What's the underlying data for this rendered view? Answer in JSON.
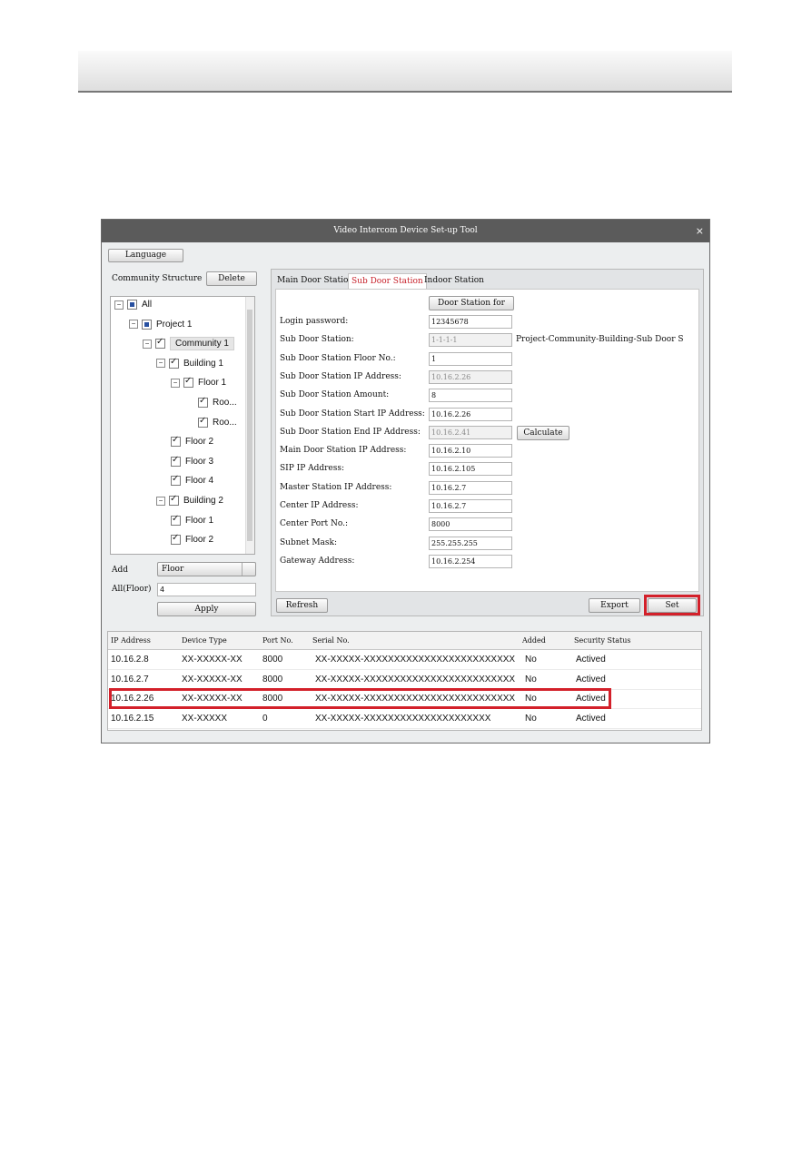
{
  "window": {
    "title": "Video Intercom Device Set-up Tool",
    "close_glyph": "×"
  },
  "toolbar": {
    "language_label": "Language"
  },
  "community": {
    "title": "Community Structure",
    "delete_label": "Delete",
    "tree": [
      {
        "label": "All",
        "level": 0,
        "expander": "−",
        "check": "part"
      },
      {
        "label": "Project 1",
        "level": 1,
        "expander": "−",
        "check": "part"
      },
      {
        "label": "Community 1",
        "level": 2,
        "expander": "−",
        "check": "chk",
        "selected": true
      },
      {
        "label": "Building 1",
        "level": 3,
        "expander": "−",
        "check": "chk"
      },
      {
        "label": "Floor 1",
        "level": 4,
        "expander": "−",
        "check": "chk"
      },
      {
        "label": "Roo...",
        "level": 5,
        "expander": "",
        "check": "chk"
      },
      {
        "label": "Roo...",
        "level": 5,
        "expander": "",
        "check": "chk"
      },
      {
        "label": "Floor 2",
        "level": 4,
        "expander": "",
        "check": "chk"
      },
      {
        "label": "Floor 3",
        "level": 4,
        "expander": "",
        "check": "chk"
      },
      {
        "label": "Floor 4",
        "level": 4,
        "expander": "",
        "check": "chk"
      },
      {
        "label": "Building 2",
        "level": 3,
        "expander": "−",
        "check": "chk"
      },
      {
        "label": "Floor 1",
        "level": 4,
        "expander": "",
        "check": "chk"
      },
      {
        "label": "Floor 2",
        "level": 4,
        "expander": "",
        "check": "chk"
      }
    ],
    "add_label": "Add",
    "add_value": "Floor",
    "all_floor_label": "All(Floor)",
    "all_floor_value": "4",
    "apply_label": "Apply"
  },
  "tabs": [
    {
      "label": "Main Door Station",
      "active": false
    },
    {
      "label": "Sub Door Station",
      "active": true
    },
    {
      "label": "Indoor Station",
      "active": false
    }
  ],
  "form": {
    "door_station_btn": "Door Station for",
    "fields": [
      {
        "label": "Login password:",
        "value": "12345678",
        "disabled": false
      },
      {
        "label": "Sub Door Station:",
        "value": "1-1-1-1",
        "disabled": true,
        "suffix": "Project-Community-Building-Sub Door S"
      },
      {
        "label": "Sub Door Station Floor No.:",
        "value": "1",
        "disabled": false
      },
      {
        "label": "Sub Door Station IP Address:",
        "value": "10.16.2.26",
        "disabled": true
      },
      {
        "label": "Sub Door Station Amount:",
        "value": "8",
        "disabled": false
      },
      {
        "label": "Sub Door Station Start IP Address:",
        "value": "10.16.2.26",
        "disabled": false
      },
      {
        "label": "Sub Door Station End IP Address:",
        "value": "10.16.2.41",
        "disabled": true
      },
      {
        "label": "Main Door Station IP Address:",
        "value": "10.16.2.10",
        "disabled": false
      },
      {
        "label": "SIP IP Address:",
        "value": "10.16.2.105",
        "disabled": false
      },
      {
        "label": "Master Station IP Address:",
        "value": "10.16.2.7",
        "disabled": false
      },
      {
        "label": "Center IP Address:",
        "value": "10.16.2.7",
        "disabled": false
      },
      {
        "label": "Center Port No.:",
        "value": "8000",
        "disabled": false
      },
      {
        "label": "Subnet Mask:",
        "value": "255.255.255",
        "disabled": false
      },
      {
        "label": "Gateway Address:",
        "value": "10.16.2.254",
        "disabled": false
      }
    ],
    "calculate_label": "Calculate",
    "refresh_label": "Refresh",
    "export_label": "Export",
    "set_label": "Set"
  },
  "device_table": {
    "columns": [
      "IP Address",
      "Device Type",
      "Port No.",
      "Serial No.",
      "Added",
      "Security Status"
    ],
    "rows": [
      [
        "10.16.2.8",
        "XX-XXXXX-XX",
        "8000",
        "XX-XXXXX-XXXXXXXXXXXXXXXXXXXXXXXXX",
        "No",
        "Actived"
      ],
      [
        "10.16.2.7",
        "XX-XXXXX-XX",
        "8000",
        "XX-XXXXX-XXXXXXXXXXXXXXXXXXXXXXXXX",
        "No",
        "Actived"
      ],
      [
        "10.16.2.26",
        "XX-XXXXX-XX",
        "8000",
        "XX-XXXXX-XXXXXXXXXXXXXXXXXXXXXXXXX",
        "No",
        "Actived"
      ],
      [
        "10.16.2.15",
        "XX-XXXXX",
        "0",
        "XX-XXXXX-XXXXXXXXXXXXXXXXXXXXX",
        "No",
        "Actived"
      ]
    ],
    "highlighted_row": 2
  },
  "colors": {
    "highlight": "#d3202a",
    "titlebar": "#5b5b5b",
    "active_tab_text": "#c8232c"
  }
}
